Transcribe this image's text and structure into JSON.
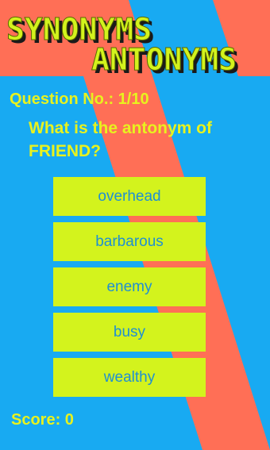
{
  "app": {
    "title_line1": "SYNONYMS",
    "title_line2": "ANTONYMS"
  },
  "colors": {
    "blue": "#18aaf2",
    "coral": "#ff6f56",
    "answer_bg": "#d3f31d",
    "answer_text": "#1f8fd3",
    "label_text": "#e8f21e"
  },
  "quiz": {
    "question_number": "Question No.: 1/10",
    "question": "What is the antonym of FRIEND?",
    "answers": [
      "overhead",
      "barbarous",
      "enemy",
      "busy",
      "wealthy"
    ],
    "score": "Score: 0"
  }
}
